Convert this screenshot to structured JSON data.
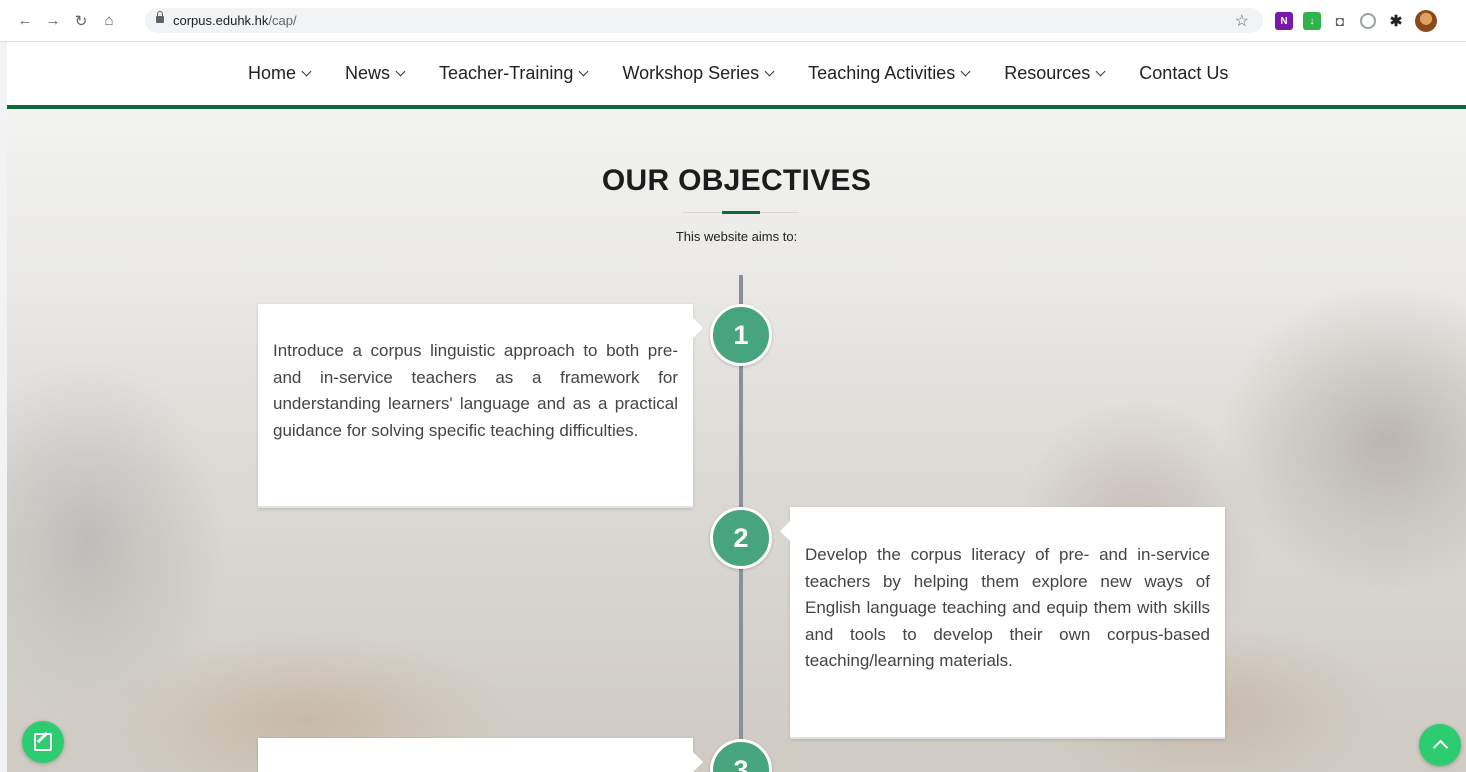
{
  "browser": {
    "url_host": "corpus.eduhk.hk",
    "url_path": "/cap/"
  },
  "nav": {
    "items": [
      {
        "label": "Home",
        "dropdown": true
      },
      {
        "label": "News",
        "dropdown": true
      },
      {
        "label": "Teacher-Training",
        "dropdown": true
      },
      {
        "label": "Workshop Series",
        "dropdown": true
      },
      {
        "label": "Teaching Activities",
        "dropdown": true
      },
      {
        "label": "Resources",
        "dropdown": true
      },
      {
        "label": "Contact Us",
        "dropdown": false
      }
    ]
  },
  "objectives": {
    "title": "OUR OBJECTIVES",
    "subtitle": "This website aims to:",
    "items": [
      {
        "number": "1",
        "text": "Introduce a corpus linguistic approach to both pre- and in-service teachers as a framework for understanding learners' language and as a practical guidance for solving specific teaching difficulties."
      },
      {
        "number": "2",
        "text": "Develop the corpus literacy of pre- and in-service teachers by helping them explore new ways of English language teaching and equip them with skills and tools to develop their own corpus-based teaching/learning materials."
      },
      {
        "number": "3",
        "text": ""
      }
    ]
  },
  "colors": {
    "brand_green": "#0d6b3b",
    "timeline_badge": "#47a57d",
    "fab": "#2ecc71"
  }
}
